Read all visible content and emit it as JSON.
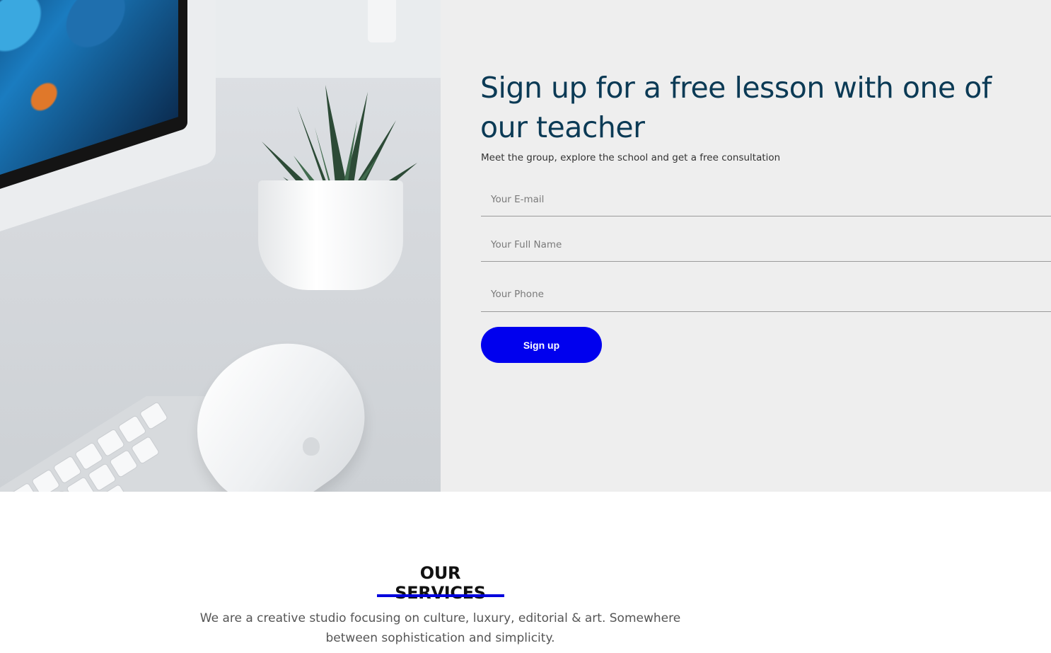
{
  "hero": {
    "image_alt": "Desk with iMac, succulent plant in a white pot, Magic Mouse and keyboard",
    "signup": {
      "title": "Sign up for a free lesson with one of our teacher",
      "subtitle": "Meet the group, explore the school and get a free consultation",
      "fields": {
        "email_placeholder": "Your E-mail",
        "name_placeholder": "Your Full Name",
        "phone_placeholder": "Your Phone"
      },
      "button_label": "Sign up"
    }
  },
  "services": {
    "title": "OUR SERVICES",
    "description": "We are a creative studio focusing on culture, luxury, editorial & art. Somewhere between sophistication and simplicity."
  },
  "colors": {
    "accent": "#0000EE",
    "title": "#0B3A55",
    "panel_bg": "#EEEEEE"
  }
}
